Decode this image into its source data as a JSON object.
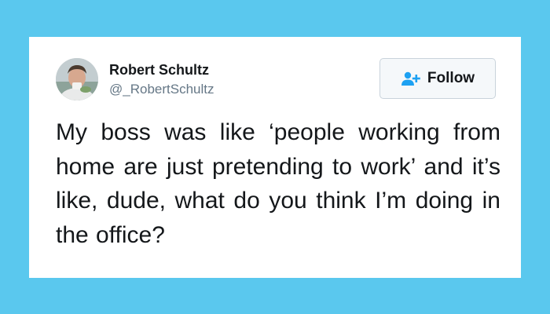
{
  "tweet": {
    "author": {
      "name": "Robert Schultz",
      "handle": "@_RobertSchultz",
      "avatar_icon": "profile-photo"
    },
    "follow_button": {
      "label": "Follow",
      "icon": "add-user-icon",
      "accent_color": "#1da1f2"
    },
    "text": "My boss was like ‘people working from home are just pretending to work’ and it’s like, dude, what do you think I’m doing in the office?"
  },
  "colors": {
    "background": "#5ac8ee",
    "card": "#ffffff",
    "text": "#14171a",
    "handle": "#657786"
  }
}
